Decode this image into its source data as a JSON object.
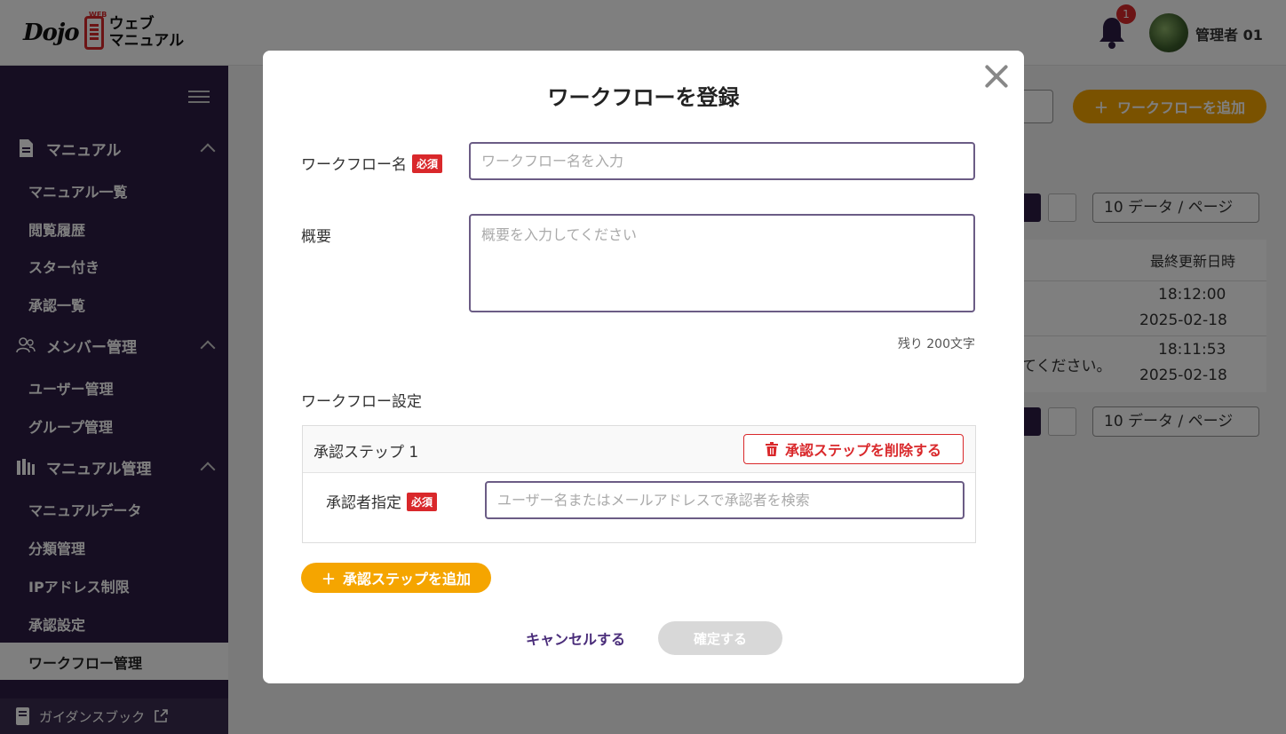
{
  "header": {
    "logo_dojo": "Dojo",
    "logo_web": "WEB",
    "logo_line1": "ウェブ",
    "logo_line2": "マニュアル",
    "notification_count": "1",
    "user_name": "管理者 01"
  },
  "sidebar": {
    "sections": [
      {
        "label": "マニュアル",
        "items": [
          "マニュアル一覧",
          "閲覧履歴",
          "スター付き",
          "承認一覧"
        ]
      },
      {
        "label": "メンバー管理",
        "items": [
          "ユーザー管理",
          "グループ管理"
        ]
      },
      {
        "label": "マニュアル管理",
        "items": [
          "マニュアルデータ",
          "分類管理",
          "IPアドレス制限",
          "承認設定",
          "ワークフロー管理"
        ]
      }
    ],
    "active_item": "ワークフロー管理",
    "guide_label": "ガイダンスブック"
  },
  "background": {
    "add_button": "ワークフローを追加",
    "per_page": "10 データ / ページ",
    "column_updated": "最終更新日時",
    "rows": [
      {
        "time": "18:12:00",
        "date": "2025-02-18"
      },
      {
        "time": "18:11:53",
        "date": "2025-02-18"
      }
    ],
    "row_fragment": "てください。"
  },
  "modal": {
    "title": "ワークフローを登録",
    "name_label": "ワークフロー名",
    "required_badge": "必須",
    "name_placeholder": "ワークフロー名を入力",
    "summary_label": "概要",
    "summary_placeholder": "概要を入力してください",
    "counter": "残り 200文字",
    "settings_label": "ワークフロー設定",
    "step_label": "承認ステップ 1",
    "delete_step": "承認ステップを削除する",
    "approver_label": "承認者指定",
    "approver_placeholder": "ユーザー名またはメールアドレスで承認者を検索",
    "add_step": "承認ステップを追加",
    "cancel": "キャンセルする",
    "confirm": "確定する"
  },
  "colors": {
    "accent": "#f5a500",
    "sidebar": "#2c1d45",
    "danger": "#d9282b",
    "primary_text": "#4a2d7a"
  }
}
